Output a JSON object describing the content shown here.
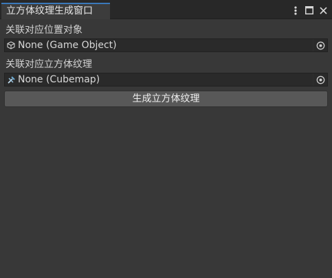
{
  "window": {
    "tab_title": "立方体纹理生成窗口",
    "controls": {
      "menu_icon": "kebab-icon",
      "maximize_icon": "maximize-icon",
      "close_icon": "close-icon"
    }
  },
  "form": {
    "target_label": "关联对应位置对象",
    "target_value": "None (Game Object)",
    "target_icon": "cube-icon",
    "cubemap_label": "关联对应立方体纹理",
    "cubemap_value": "None (Cubemap)",
    "cubemap_icon": "cubemap-icon",
    "picker_icon": "object-picker-icon",
    "generate_label": "生成立方体纹理"
  },
  "colors": {
    "tab_accent": "#3a79bb",
    "background": "#383838",
    "field_bg": "#2a2a2a",
    "button_bg": "#585858"
  }
}
